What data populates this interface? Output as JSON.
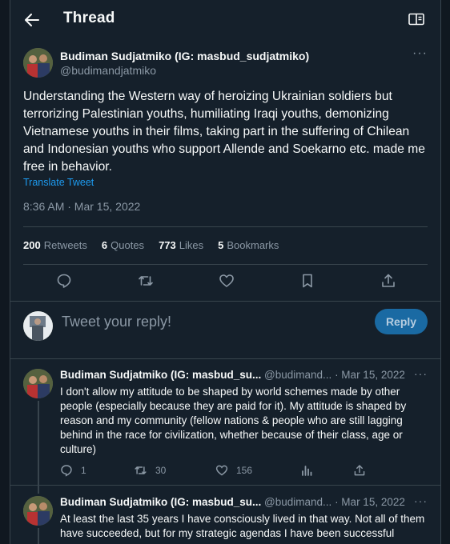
{
  "header": {
    "title": "Thread"
  },
  "main_tweet": {
    "author_name": "Budiman Sudjatmiko (IG: masbud_sudjatmiko)",
    "author_handle": "@budimandjatmiko",
    "text": "Understanding the Western way of heroizing Ukrainian soldiers but terrorizing Palestinian youths, humiliating Iraqi youths, demonizing Vietnamese youths in their films, taking part in the suffering of Chilean and Indonesian youths who support Allende and Soekarno etc. made me free in behavior.",
    "translate_label": "Translate Tweet",
    "timestamp": "8:36 AM · Mar 15, 2022",
    "stats": [
      {
        "count": "200",
        "label": "Retweets"
      },
      {
        "count": "6",
        "label": "Quotes"
      },
      {
        "count": "773",
        "label": "Likes"
      },
      {
        "count": "5",
        "label": "Bookmarks"
      }
    ],
    "more": "···"
  },
  "reply_box": {
    "placeholder": "Tweet your reply!",
    "button_label": "Reply"
  },
  "replies": [
    {
      "name": "Budiman Sudjatmiko (IG: masbud_su...",
      "handle": "@budimand...",
      "date": "· Mar 15, 2022",
      "more": "···",
      "text": "I don't allow my attitude to be shaped by world schemes made by other people (especially because they are paid for it). My attitude is shaped by reason and my community (fellow nations & people who are still lagging behind in the race for civilization, whether because of their class, age or culture)",
      "replies_count": "1",
      "retweets_count": "30",
      "likes_count": "156"
    },
    {
      "name": "Budiman Sudjatmiko (IG: masbud_su...",
      "handle": "@budimand...",
      "date": "· Mar 15, 2022",
      "more": "···",
      "text": "At least the last 35 years I have consciously lived in that way. Not all of them have succeeded, but for my strategic agendas I have been successful"
    }
  ],
  "colors": {
    "background": "#15202b",
    "accent": "#1d9bf0",
    "muted": "#8b98a5",
    "divider": "#38444d"
  },
  "icons": [
    "back-arrow-icon",
    "reader-mode-icon",
    "reply-icon",
    "retweet-icon",
    "like-icon",
    "bookmark-icon",
    "share-icon",
    "views-icon"
  ]
}
